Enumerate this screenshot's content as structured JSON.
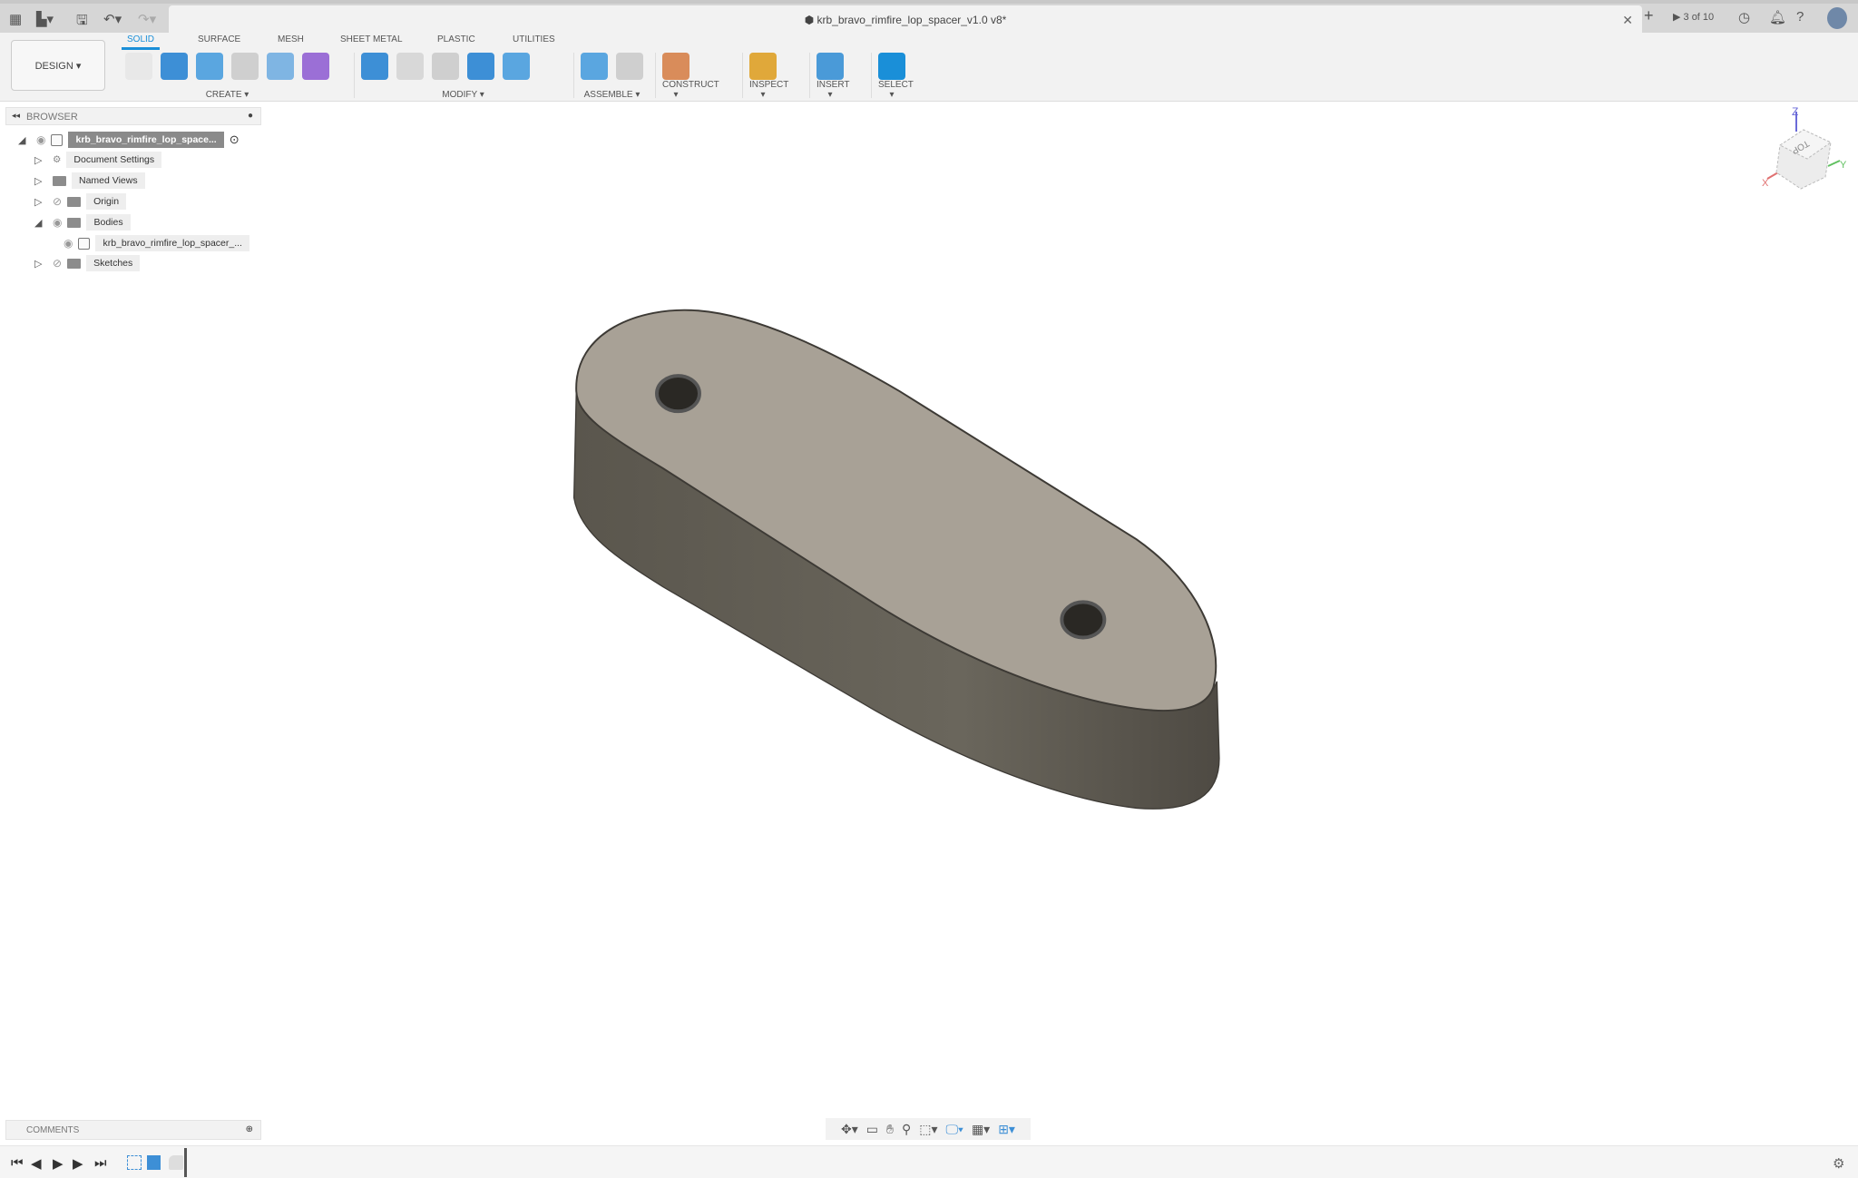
{
  "window": {
    "title": "krb_bravo_rimfire_lop_spacer_v1.0 v8*",
    "job_status": "3 of 10"
  },
  "topbar_icons": [
    "apps-grid-icon",
    "file-icon",
    "save-icon",
    "undo-icon",
    "redo-icon"
  ],
  "workspace": {
    "button": "DESIGN ▾",
    "tabs": [
      "SOLID",
      "SURFACE",
      "MESH",
      "SHEET METAL",
      "PLASTIC",
      "UTILITIES"
    ],
    "active_tab": "SOLID"
  },
  "toolbar": {
    "groups": [
      {
        "label": "CREATE ▾",
        "icons": [
          [
            "new-sketch-icon",
            "#e8e8e8"
          ],
          [
            "extrude-icon",
            "#3d8fd6"
          ],
          [
            "revolve-icon",
            "#5aa6e0"
          ],
          [
            "hole-icon",
            "#cfcfcf"
          ],
          [
            "pattern-icon",
            "#7fb5e3"
          ],
          [
            "form-icon",
            "#9b6fd6"
          ]
        ]
      },
      {
        "label": "MODIFY ▾",
        "icons": [
          [
            "press-pull-icon",
            "#3d8fd6"
          ],
          [
            "fillet-icon",
            "#d8d8d8"
          ],
          [
            "shell-icon",
            "#cfcfcf"
          ],
          [
            "combine-icon",
            "#3d8fd6"
          ],
          [
            "split-face-icon",
            "#5aa6e0"
          ],
          [
            "move-icon",
            "#f2f2f2"
          ]
        ]
      },
      {
        "label": "ASSEMBLE ▾",
        "icons": [
          [
            "new-component-icon",
            "#5aa6e0"
          ],
          [
            "joint-icon",
            "#cfcfcf"
          ]
        ]
      },
      {
        "label": "CONSTRUCT ▾",
        "icons": [
          [
            "offset-plane-icon",
            "#d98c5a"
          ]
        ]
      },
      {
        "label": "INSPECT ▾",
        "icons": [
          [
            "measure-icon",
            "#e0a83a"
          ]
        ]
      },
      {
        "label": "INSERT ▾",
        "icons": [
          [
            "insert-image-icon",
            "#4a9ad8"
          ]
        ]
      },
      {
        "label": "SELECT ▾",
        "icons": [
          [
            "select-icon",
            "#1a8fd8"
          ]
        ]
      }
    ]
  },
  "browser": {
    "title": "BROWSER",
    "items": [
      {
        "label": "krb_bravo_rimfire_lop_space...",
        "expanded": true
      },
      {
        "label": "Document Settings",
        "expanded": false
      },
      {
        "label": "Named Views",
        "expanded": false
      },
      {
        "label": "Origin",
        "expanded": false
      },
      {
        "label": "Bodies",
        "expanded": true
      },
      {
        "label": "krb_bravo_rimfire_lop_spacer_..."
      },
      {
        "label": "Sketches",
        "expanded": false
      }
    ]
  },
  "viewcube": {
    "face": "TOP",
    "axes": {
      "x": "X",
      "y": "Y",
      "z": "Z"
    }
  },
  "comments": {
    "title": "COMMENTS"
  },
  "model": {
    "top_color": "#a8a196",
    "side_color": "#5f5b52"
  }
}
